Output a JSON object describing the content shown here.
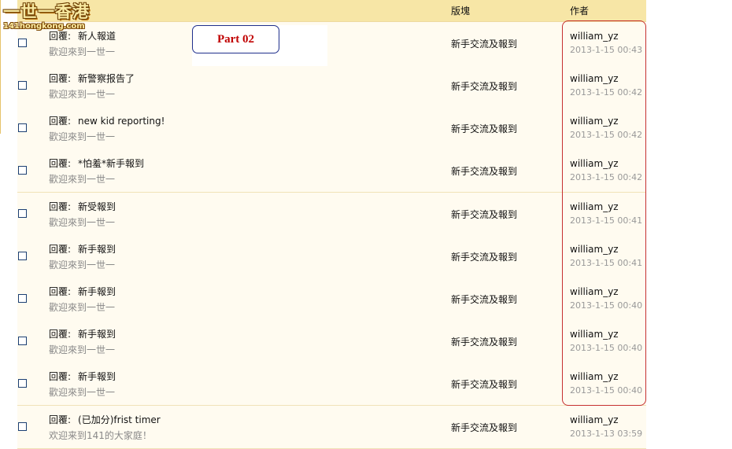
{
  "logo": {
    "title": "一世一香港",
    "domain": "141hongkong.com"
  },
  "columns": {
    "board": "版塊",
    "author": "作者"
  },
  "annotation": {
    "label": "Part 02"
  },
  "rows": [
    {
      "prefix": "回覆:",
      "title": "新人報道",
      "subtitle": "歡迎來到一世一",
      "board": "新手交流及報到",
      "author": "william_yz",
      "date": "2013-1-15 00:43"
    },
    {
      "prefix": "回覆:",
      "title": "新警察报告了",
      "subtitle": "歡迎來到一世一",
      "board": "新手交流及報到",
      "author": "william_yz",
      "date": "2013-1-15 00:42"
    },
    {
      "prefix": "回覆:",
      "title": "new kid reporting!",
      "subtitle": "歡迎來到一世一",
      "board": "新手交流及報到",
      "author": "william_yz",
      "date": "2013-1-15 00:42"
    },
    {
      "prefix": "回覆:",
      "title": "*怕羞*新手報到",
      "subtitle": "歡迎來到一世一",
      "board": "新手交流及報到",
      "author": "william_yz",
      "date": "2013-1-15 00:42"
    },
    {
      "prefix": "回覆:",
      "title": "新受報到",
      "subtitle": "歡迎來到一世一",
      "board": "新手交流及報到",
      "author": "william_yz",
      "date": "2013-1-15 00:41"
    },
    {
      "prefix": "回覆:",
      "title": "新手報到",
      "subtitle": "歡迎來到一世一",
      "board": "新手交流及報到",
      "author": "william_yz",
      "date": "2013-1-15 00:41"
    },
    {
      "prefix": "回覆:",
      "title": "新手報到",
      "subtitle": "歡迎來到一世一",
      "board": "新手交流及報到",
      "author": "william_yz",
      "date": "2013-1-15 00:40"
    },
    {
      "prefix": "回覆:",
      "title": "新手報到",
      "subtitle": "歡迎來到一世一",
      "board": "新手交流及報到",
      "author": "william_yz",
      "date": "2013-1-15 00:40"
    },
    {
      "prefix": "回覆:",
      "title": "新手報到",
      "subtitle": "歡迎來到一世一",
      "board": "新手交流及報到",
      "author": "william_yz",
      "date": "2013-1-15 00:40"
    },
    {
      "prefix": "回覆:",
      "title": "(已加分)frist timer",
      "subtitle": "欢迎来到141的大家庭！",
      "board": "新手交流及報到",
      "author": "william_yz",
      "date": "2013-1-13 03:59"
    }
  ]
}
